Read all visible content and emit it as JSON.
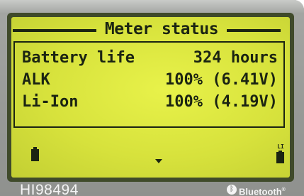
{
  "screen": {
    "title": "Meter status",
    "rows": [
      {
        "label": "Battery life",
        "value": "324 hours"
      },
      {
        "label": "ALK",
        "value": "100% (6.41V)"
      },
      {
        "label": "Li-Ion",
        "value": "100% (4.19V)"
      }
    ],
    "right_battery_label": "LI",
    "lcd_color": "#d7e23c",
    "segment_color": "#1b2412"
  },
  "device": {
    "model": "HI98494",
    "bluetooth_label": "Bluetooth",
    "bluetooth_mark": "®",
    "bluetooth_icon_glyph": "ᛒ"
  }
}
